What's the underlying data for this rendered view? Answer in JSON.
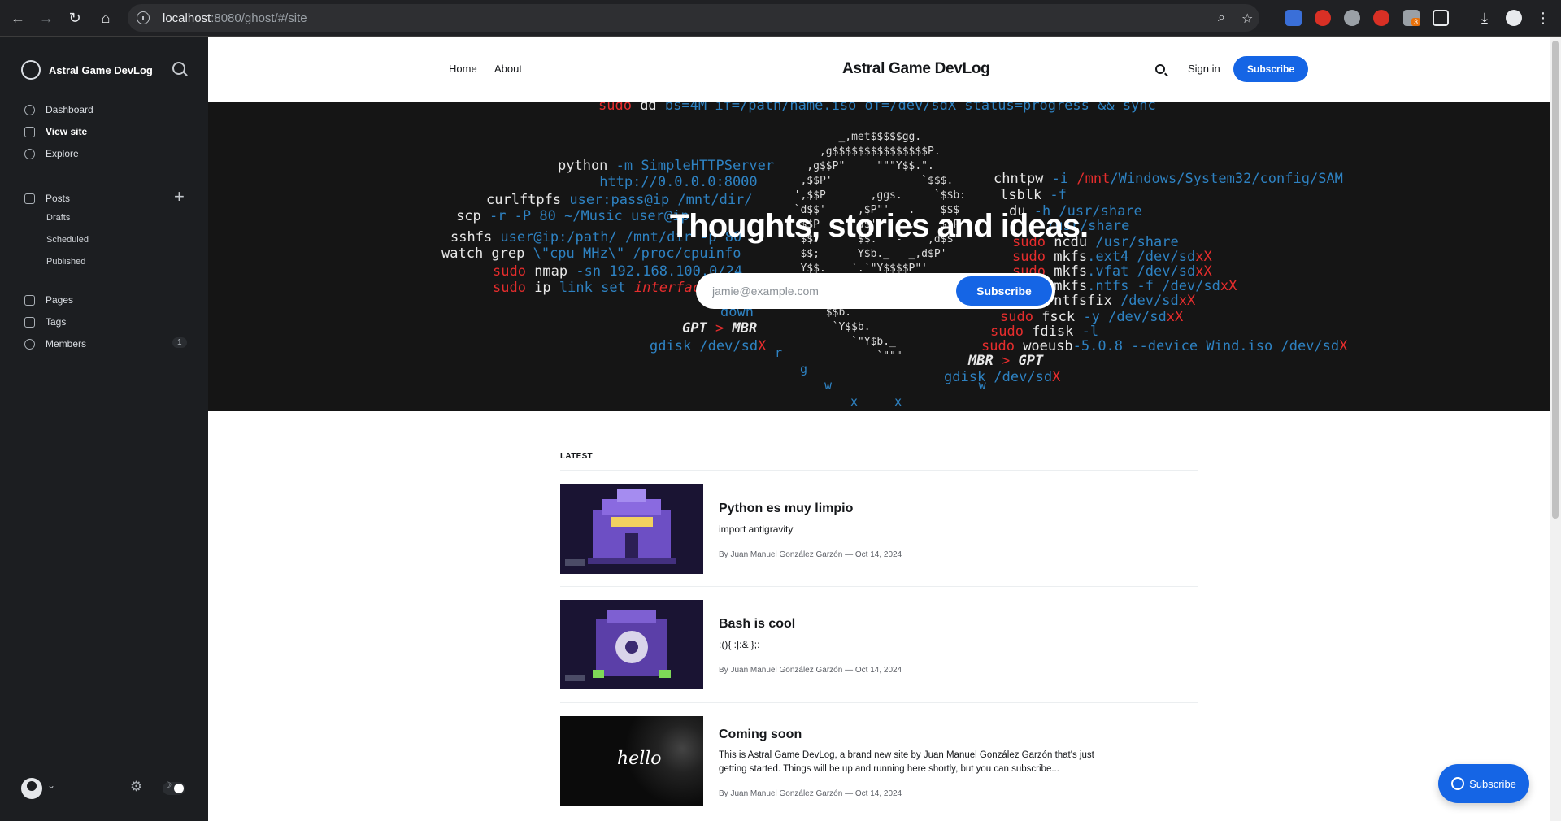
{
  "browser": {
    "url_host": "localhost",
    "url_rest": ":8080/ghost/#/site",
    "extension_badge": "3"
  },
  "sidebar": {
    "site_title": "Astral Game DevLog",
    "dashboard": "Dashboard",
    "view_site": "View site",
    "explore": "Explore",
    "posts": "Posts",
    "drafts": "Drafts",
    "scheduled": "Scheduled",
    "published": "Published",
    "pages": "Pages",
    "tags": "Tags",
    "members": "Members",
    "members_count": "1"
  },
  "site_header": {
    "nav_home": "Home",
    "nav_about": "About",
    "title": "Astral Game DevLog",
    "sign_in": "Sign in",
    "subscribe": "Subscribe"
  },
  "hero": {
    "heading": "Thoughts, stories and ideas.",
    "email_placeholder": "jamie@example.com",
    "subscribe": "Subscribe"
  },
  "feed": {
    "section_label": "LATEST",
    "posts": [
      {
        "title": "Python es muy limpio",
        "excerpt": "import antigravity",
        "meta": "By Juan Manuel González Garzón — Oct 14, 2024"
      },
      {
        "title": "Bash is cool",
        "excerpt": ":(){ :|:& };:",
        "meta": "By Juan Manuel González Garzón — Oct 14, 2024"
      },
      {
        "title": "Coming soon",
        "excerpt": "This is Astral Game DevLog, a brand new site by Juan Manuel González Garzón that's just getting started. Things will be up and running here shortly, but you can subscribe...",
        "meta": "By Juan Manuel González Garzón — Oct 14, 2024",
        "thumb_text": "hello"
      }
    ]
  },
  "portal": {
    "label": "Subscribe"
  }
}
